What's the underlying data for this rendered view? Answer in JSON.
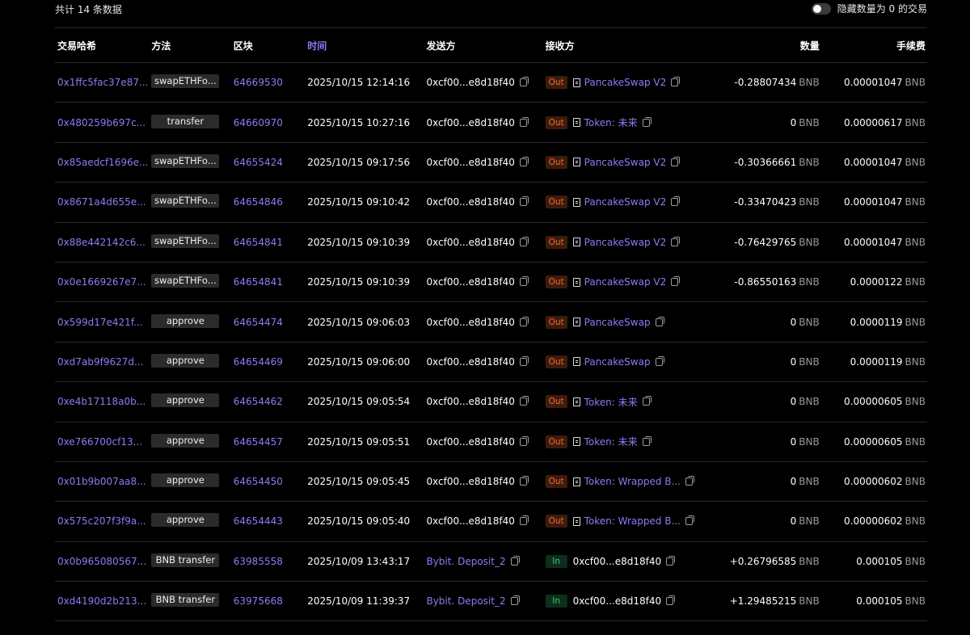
{
  "header": {
    "total_text": "共计 14 条数据",
    "hide_label": "隐藏数量为 0 的交易"
  },
  "columns": {
    "hash": "交易哈希",
    "method": "方法",
    "block": "区块",
    "time": "时间",
    "from": "发送方",
    "to": "接收方",
    "amount": "数量",
    "fee": "手续费"
  },
  "unit": "BNB",
  "colors": {
    "accent": "#8b7cf6",
    "out": "#f36a2a",
    "in": "#2ecc71"
  },
  "rows": [
    {
      "hash": "0x1ffc5fac37e87...",
      "method": "swapETHFo...",
      "block": "64669530",
      "time": "2025/10/15 12:14:16",
      "from": "0xcf00...e8d18f40",
      "from_link": false,
      "dir": "Out",
      "to": "PancakeSwap V2",
      "to_doc": true,
      "to_link": true,
      "amount": "-0.28807434",
      "fee": "0.00001047"
    },
    {
      "hash": "0x480259b697c...",
      "method": "transfer",
      "block": "64660970",
      "time": "2025/10/15 10:27:16",
      "from": "0xcf00...e8d18f40",
      "from_link": false,
      "dir": "Out",
      "to": "Token: 未来",
      "to_doc": true,
      "to_link": true,
      "amount": "0",
      "fee": "0.00000617"
    },
    {
      "hash": "0x85aedcf1696e...",
      "method": "swapETHFo...",
      "block": "64655424",
      "time": "2025/10/15 09:17:56",
      "from": "0xcf00...e8d18f40",
      "from_link": false,
      "dir": "Out",
      "to": "PancakeSwap V2",
      "to_doc": true,
      "to_link": true,
      "amount": "-0.30366661",
      "fee": "0.00001047"
    },
    {
      "hash": "0x8671a4d655e...",
      "method": "swapETHFo...",
      "block": "64654846",
      "time": "2025/10/15 09:10:42",
      "from": "0xcf00...e8d18f40",
      "from_link": false,
      "dir": "Out",
      "to": "PancakeSwap V2",
      "to_doc": true,
      "to_link": true,
      "amount": "-0.33470423",
      "fee": "0.00001047"
    },
    {
      "hash": "0x88e442142c6...",
      "method": "swapETHFo...",
      "block": "64654841",
      "time": "2025/10/15 09:10:39",
      "from": "0xcf00...e8d18f40",
      "from_link": false,
      "dir": "Out",
      "to": "PancakeSwap V2",
      "to_doc": true,
      "to_link": true,
      "amount": "-0.76429765",
      "fee": "0.00001047"
    },
    {
      "hash": "0x0e1669267e7...",
      "method": "swapETHFo...",
      "block": "64654841",
      "time": "2025/10/15 09:10:39",
      "from": "0xcf00...e8d18f40",
      "from_link": false,
      "dir": "Out",
      "to": "PancakeSwap V2",
      "to_doc": true,
      "to_link": true,
      "amount": "-0.86550163",
      "fee": "0.0000122"
    },
    {
      "hash": "0x599d17e421f...",
      "method": "approve",
      "block": "64654474",
      "time": "2025/10/15 09:06:03",
      "from": "0xcf00...e8d18f40",
      "from_link": false,
      "dir": "Out",
      "to": "PancakeSwap",
      "to_doc": true,
      "to_link": true,
      "amount": "0",
      "fee": "0.0000119"
    },
    {
      "hash": "0xd7ab9f9627d...",
      "method": "approve",
      "block": "64654469",
      "time": "2025/10/15 09:06:00",
      "from": "0xcf00...e8d18f40",
      "from_link": false,
      "dir": "Out",
      "to": "PancakeSwap",
      "to_doc": true,
      "to_link": true,
      "amount": "0",
      "fee": "0.0000119"
    },
    {
      "hash": "0xe4b17118a0b...",
      "method": "approve",
      "block": "64654462",
      "time": "2025/10/15 09:05:54",
      "from": "0xcf00...e8d18f40",
      "from_link": false,
      "dir": "Out",
      "to": "Token: 未来",
      "to_doc": true,
      "to_link": true,
      "amount": "0",
      "fee": "0.00000605"
    },
    {
      "hash": "0xe766700cf13...",
      "method": "approve",
      "block": "64654457",
      "time": "2025/10/15 09:05:51",
      "from": "0xcf00...e8d18f40",
      "from_link": false,
      "dir": "Out",
      "to": "Token: 未来",
      "to_doc": true,
      "to_link": true,
      "amount": "0",
      "fee": "0.00000605"
    },
    {
      "hash": "0x01b9b007aa8...",
      "method": "approve",
      "block": "64654450",
      "time": "2025/10/15 09:05:45",
      "from": "0xcf00...e8d18f40",
      "from_link": false,
      "dir": "Out",
      "to": "Token: Wrapped B...",
      "to_doc": true,
      "to_link": true,
      "amount": "0",
      "fee": "0.00000602"
    },
    {
      "hash": "0x575c207f3f9a...",
      "method": "approve",
      "block": "64654443",
      "time": "2025/10/15 09:05:40",
      "from": "0xcf00...e8d18f40",
      "from_link": false,
      "dir": "Out",
      "to": "Token: Wrapped B...",
      "to_doc": true,
      "to_link": true,
      "amount": "0",
      "fee": "0.00000602"
    },
    {
      "hash": "0x0b965080567...",
      "method": "BNB transfer",
      "block": "63985558",
      "time": "2025/10/09 13:43:17",
      "from": "Bybit. Deposit_2",
      "from_link": true,
      "dir": "In",
      "to": "0xcf00...e8d18f40",
      "to_doc": false,
      "to_link": false,
      "amount": "+0.26796585",
      "fee": "0.000105"
    },
    {
      "hash": "0xd4190d2b213...",
      "method": "BNB transfer",
      "block": "63975668",
      "time": "2025/10/09 11:39:37",
      "from": "Bybit. Deposit_2",
      "from_link": true,
      "dir": "In",
      "to": "0xcf00...e8d18f40",
      "to_doc": false,
      "to_link": false,
      "amount": "+1.29485215",
      "fee": "0.000105"
    }
  ]
}
